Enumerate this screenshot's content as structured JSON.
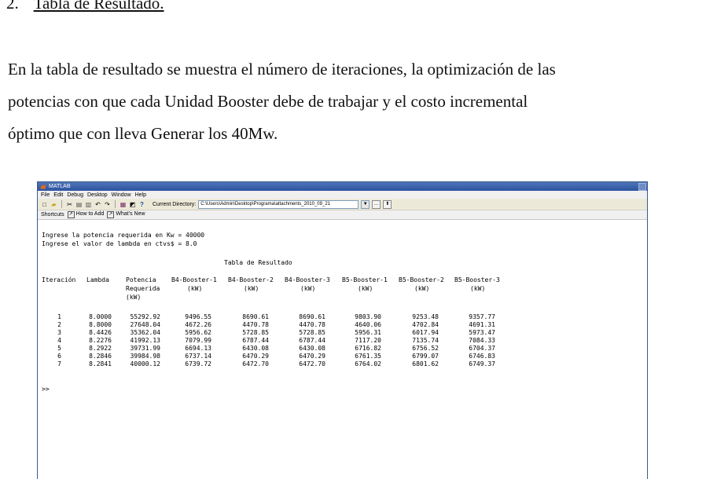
{
  "heading": {
    "number": "2.",
    "title": "Tabla de Resultado."
  },
  "paragraph": {
    "lines": [
      "En la tabla de resultado se muestra el número de iteraciones, la optimización de las",
      "potencias con que cada Unidad Booster debe de trabajar y el costo incremental",
      "óptimo que con lleva Generar los 40Mw."
    ]
  },
  "matlab": {
    "title": "MATLAB",
    "menu": [
      "File",
      "Edit",
      "Debug",
      "Desktop",
      "Window",
      "Help"
    ],
    "current_directory_label": "Current Directory:",
    "current_directory_value": "C:\\Users\\Admin\\Desktop\\Programa\\attachments_2010_09_21",
    "shortcuts": [
      "Shortcuts",
      "How to Add",
      "What's New"
    ],
    "console": {
      "input_line_1": "Ingrese la potencia requerida en Kw = 40000",
      "input_line_2": "Ingrese el valor de lambda en ctvs$ = 8.0",
      "table_title": "Tabla de Resultado",
      "headers": [
        [
          "Iteración",
          "",
          ""
        ],
        [
          "Lambda",
          "",
          ""
        ],
        [
          "Potencia",
          "Requerida",
          "(kW)"
        ],
        [
          "B4-Booster-1",
          "(kW)",
          ""
        ],
        [
          "B4-Booster-2",
          "(kW)",
          ""
        ],
        [
          "B4-Booster-3",
          "(kW)",
          ""
        ],
        [
          "B5-Booster-1",
          "(kW)",
          ""
        ],
        [
          "B5-Booster-2",
          "(kW)",
          ""
        ],
        [
          "B5-Booster-3",
          "(kW)",
          ""
        ]
      ],
      "rows": [
        [
          "1",
          "8.0000",
          "55292.92",
          "9496.55",
          "8690.61",
          "8690.61",
          "9803.90",
          "9253.48",
          "9357.77"
        ],
        [
          "2",
          "8.8000",
          "27648.04",
          "4672.26",
          "4470.78",
          "4470.78",
          "4640.06",
          "4702.84",
          "4691.31"
        ],
        [
          "3",
          "8.4426",
          "35362.04",
          "5956.62",
          "5728.85",
          "5728.85",
          "5956.31",
          "6017.94",
          "5973.47"
        ],
        [
          "4",
          "8.2276",
          "41992.13",
          "7079.99",
          "6787.44",
          "6787.44",
          "7117.20",
          "7135.74",
          "7084.33"
        ],
        [
          "5",
          "8.2922",
          "39731.99",
          "6694.13",
          "6430.08",
          "6430.08",
          "6716.82",
          "6756.52",
          "6704.37"
        ],
        [
          "6",
          "8.2846",
          "39984.98",
          "6737.14",
          "6470.29",
          "6470.29",
          "6761.35",
          "6799.07",
          "6746.83"
        ],
        [
          "7",
          "8.2841",
          "40000.12",
          "6739.72",
          "6472.70",
          "6472.70",
          "6764.02",
          "6801.62",
          "6749.37"
        ]
      ],
      "prompt": ">>"
    }
  }
}
